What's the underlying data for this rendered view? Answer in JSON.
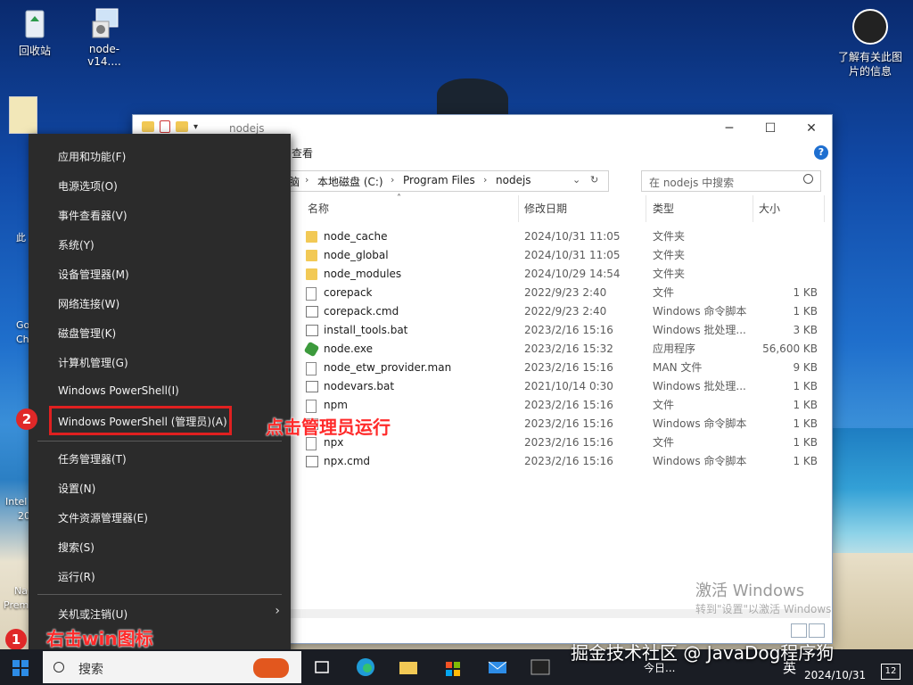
{
  "desktop": {
    "icons": [
      {
        "label": "回收站"
      },
      {
        "label": "node-v14...."
      }
    ],
    "info_icon_label": "了解有关此图片的信息",
    "left_fragments": [
      "此",
      "Go",
      "Ch",
      "Intel",
      "20",
      "Na",
      "Prem"
    ]
  },
  "explorer": {
    "title": "nodejs",
    "ribbon_view_tab": "查看",
    "address": [
      "脑",
      "本地磁盘 (C:)",
      "Program Files",
      "nodejs"
    ],
    "search_placeholder": "在 nodejs 中搜索",
    "columns": [
      "名称",
      "修改日期",
      "类型",
      "大小"
    ],
    "files": [
      {
        "name": "node_cache",
        "date": "2024/10/31 11:05",
        "type": "文件夹",
        "size": "",
        "icon": "folder"
      },
      {
        "name": "node_global",
        "date": "2024/10/31 11:05",
        "type": "文件夹",
        "size": "",
        "icon": "folder"
      },
      {
        "name": "node_modules",
        "date": "2024/10/29 14:54",
        "type": "文件夹",
        "size": "",
        "icon": "folder"
      },
      {
        "name": "corepack",
        "date": "2022/9/23 2:40",
        "type": "文件",
        "size": "1 KB",
        "icon": "file"
      },
      {
        "name": "corepack.cmd",
        "date": "2022/9/23 2:40",
        "type": "Windows 命令脚本",
        "size": "1 KB",
        "icon": "cmd"
      },
      {
        "name": "install_tools.bat",
        "date": "2023/2/16 15:16",
        "type": "Windows 批处理...",
        "size": "3 KB",
        "icon": "cmd"
      },
      {
        "name": "node.exe",
        "date": "2023/2/16 15:32",
        "type": "应用程序",
        "size": "56,600 KB",
        "icon": "exe"
      },
      {
        "name": "node_etw_provider.man",
        "date": "2023/2/16 15:16",
        "type": "MAN 文件",
        "size": "9 KB",
        "icon": "file"
      },
      {
        "name": "nodevars.bat",
        "date": "2021/10/14 0:30",
        "type": "Windows 批处理...",
        "size": "1 KB",
        "icon": "cmd"
      },
      {
        "name": "npm",
        "date": "2023/2/16 15:16",
        "type": "文件",
        "size": "1 KB",
        "icon": "file"
      },
      {
        "name": "",
        "date": "2023/2/16 15:16",
        "type": "Windows 命令脚本",
        "size": "1 KB",
        "icon": "cmd"
      },
      {
        "name": "npx",
        "date": "2023/2/16 15:16",
        "type": "文件",
        "size": "1 KB",
        "icon": "file"
      },
      {
        "name": "npx.cmd",
        "date": "2023/2/16 15:16",
        "type": "Windows 命令脚本",
        "size": "1 KB",
        "icon": "cmd"
      }
    ],
    "activate_line1": "激活 Windows",
    "activate_line2": "转到\"设置\"以激活 Windows"
  },
  "context_menu": {
    "items": [
      "应用和功能(F)",
      "电源选项(O)",
      "事件查看器(V)",
      "系统(Y)",
      "设备管理器(M)",
      "网络连接(W)",
      "磁盘管理(K)",
      "计算机管理(G)",
      "Windows PowerShell(I)",
      "Windows PowerShell (管理员)(A)",
      "任务管理器(T)",
      "设置(N)",
      "文件资源管理器(E)",
      "搜索(S)",
      "运行(R)",
      "关机或注销(U)"
    ]
  },
  "annotations": {
    "step1_badge": "1",
    "step1_text": "右击win图标",
    "step2_badge": "2",
    "step2_text": "点击管理员运行"
  },
  "taskbar": {
    "search_label": "搜索",
    "today_label": "今日...",
    "ime": "英",
    "date": "2024/10/31",
    "notification_count": "12",
    "watermark": "掘金技术社区 @ JavaDog程序狗"
  }
}
